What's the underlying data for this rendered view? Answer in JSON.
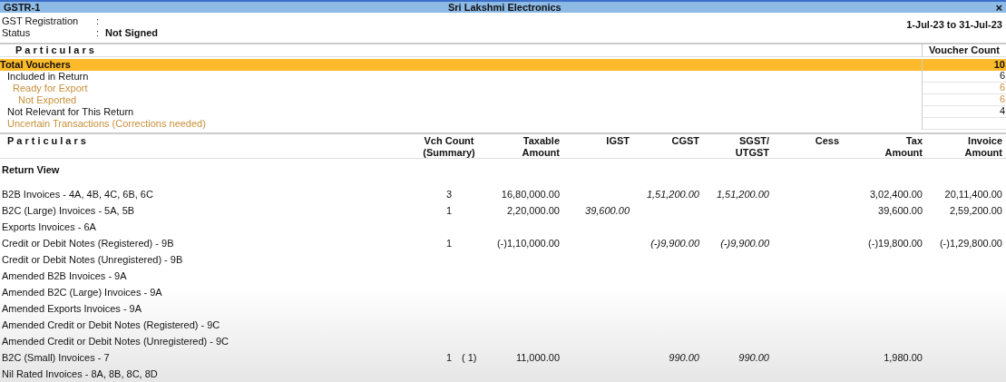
{
  "window": {
    "title": "GSTR-1",
    "company": "Sri Lakshmi Electronics",
    "close": "×"
  },
  "info": [
    {
      "label": "GST Registration",
      "separator": ":"
    },
    {
      "label": "Status",
      "separator": ":",
      "value": "Not Signed"
    }
  ],
  "period": "1-Jul-23 to 31-Jul-23",
  "summary": {
    "columns": [
      "Particulars",
      "Voucher Count"
    ],
    "rows": [
      {
        "label": "Total Vouchers",
        "count": "10",
        "selected": true,
        "children": [
          {
            "label": "Included in Return",
            "count": "6",
            "selected": false,
            "children": [
              {
                "label": "Ready for Export",
                "count": "6",
                "selected": false,
                "color": "#c8903a",
                "children": [
                  {
                    "label": "Not Exported",
                    "count": "6",
                    "selected": false,
                    "color": "#c8903a"
                  }
                ]
              }
            ]
          },
          {
            "label": "Not Relevant for This Return",
            "count": "4",
            "selected": false
          },
          {
            "label": "Uncertain Transactions (Corrections needed)",
            "selected": false,
            "color": "#c8903a"
          }
        ]
      }
    ]
  },
  "return_table": {
    "columns": [
      "Particulars",
      "Vch Count\n(Summary)",
      "Taxable\nAmount",
      "IGST",
      "CGST",
      "SGST/\nUTGST",
      "Cess",
      "Tax\nAmount",
      "Invoice\nAmount"
    ],
    "section": "Return View",
    "rows": [
      {
        "particulars": "B2B Invoices - 4A, 4B, 4C, 6B, 6C",
        "vch_count": "3",
        "taxable": "16,80,000.00",
        "cgst": "1,51,200.00",
        "sgst": "1,51,200.00",
        "tax": "3,02,400.00",
        "invoice": "20,11,400.00"
      },
      {
        "particulars": "B2C (Large) Invoices - 5A, 5B",
        "vch_count": "1",
        "taxable": "2,20,000.00",
        "igst": "39,600.00",
        "tax": "39,600.00",
        "invoice": "2,59,200.00"
      },
      {
        "particulars": "Exports Invoices - 6A"
      },
      {
        "particulars": "Credit or Debit Notes (Registered) - 9B",
        "vch_count": "1",
        "taxable": "(-)1,10,000.00",
        "cgst": "(-)9,900.00",
        "sgst": "(-)9,900.00",
        "tax": "(-)19,800.00",
        "invoice": "(-)1,29,800.00"
      },
      {
        "particulars": "Credit or Debit Notes (Unregistered) - 9B"
      },
      {
        "particulars": "Amended B2B Invoices - 9A"
      },
      {
        "particulars": "Amended B2C (Large) Invoices - 9A"
      },
      {
        "particulars": "Amended Exports Invoices - 9A"
      },
      {
        "particulars": "Amended Credit or Debit Notes (Registered) - 9C"
      },
      {
        "particulars": "Amended Credit or Debit Notes (Unregistered) - 9C"
      },
      {
        "particulars": "B2C (Small) Invoices - 7",
        "vch_count": "1",
        "summary_count": "( 1)",
        "taxable": "11,000.00",
        "cgst": "990.00",
        "sgst": "990.00",
        "tax": "1,980.00"
      },
      {
        "particulars": "Nil Rated Invoices - 8A, 8B, 8C, 8D"
      }
    ]
  }
}
